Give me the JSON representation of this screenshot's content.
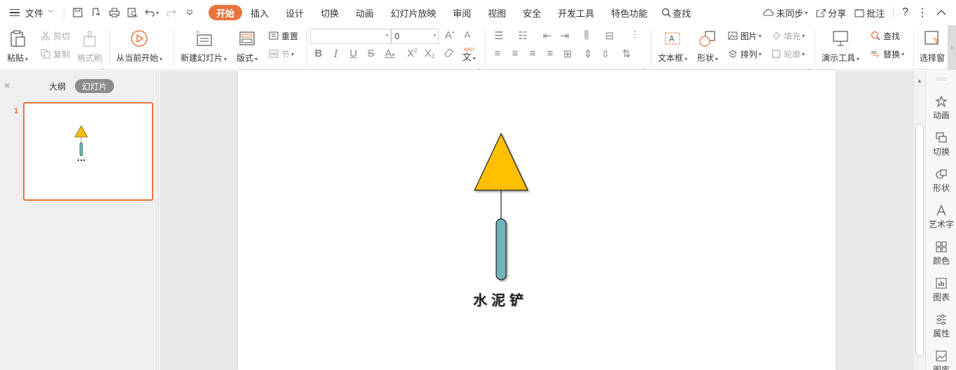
{
  "menubar": {
    "file": "文件",
    "tabs": [
      "开始",
      "插入",
      "设计",
      "切换",
      "动画",
      "幻灯片放映",
      "审阅",
      "视图",
      "安全",
      "开发工具",
      "特色功能"
    ],
    "search": "查找",
    "sync": "未同步",
    "share": "分享",
    "comment": "批注",
    "help": "?"
  },
  "ribbon": {
    "paste": "粘贴",
    "cut": "剪切",
    "copy": "复制",
    "format_painter": "格式刷",
    "play_from_current": "从当前开始",
    "new_slide": "新建幻灯片",
    "layout": "版式",
    "reset": "重置",
    "section": "节",
    "font_name": "",
    "font_size": "0",
    "wen_top": "wén",
    "wen_bottom": "文",
    "textbox": "文本框",
    "shape": "形状",
    "picture": "图片",
    "fill": "填充",
    "arrange": "排列",
    "outline": "轮廓",
    "present_tools": "演示工具",
    "find": "查找",
    "replace": "替换",
    "select_pane": "选择窗"
  },
  "left_panel": {
    "tab_outline": "大纲",
    "tab_slides": "幻灯片",
    "slide_number": "1"
  },
  "slide": {
    "label": "水泥铲",
    "colors": {
      "triangle": "#FFC000",
      "handle": "#6FB5B8",
      "accent": "#E8743B"
    }
  },
  "right_bar": {
    "items": [
      "动画",
      "切换",
      "形状",
      "艺术字",
      "颜色",
      "图表",
      "属性",
      "图库"
    ]
  }
}
